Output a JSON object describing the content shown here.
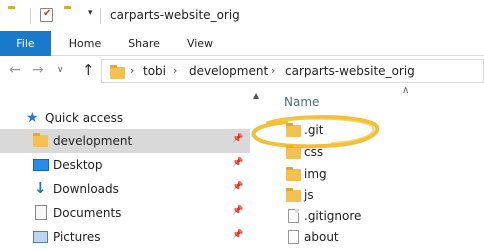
{
  "window": {
    "title": "carparts-website_orig"
  },
  "quick_access_toolbar": {
    "icons": [
      "folder-icon",
      "properties-icon",
      "new-folder-icon",
      "dropdown-icon"
    ],
    "dropdown_glyph": "▾"
  },
  "ribbon": {
    "tabs": [
      {
        "label": "File"
      },
      {
        "label": "Home"
      },
      {
        "label": "Share"
      },
      {
        "label": "View"
      }
    ]
  },
  "navigation": {
    "back_glyph": "←",
    "forward_glyph": "→",
    "recent_glyph": "∨",
    "up_glyph": "↑",
    "breadcrumb": [
      "tobi",
      "development",
      "carparts-website_orig"
    ],
    "breadcrumb_separator": "›"
  },
  "nav_pane": {
    "quick_access_label": "Quick access",
    "items": [
      {
        "label": "development",
        "icon": "folder-icon",
        "pinned": true,
        "selected": true
      },
      {
        "label": "Desktop",
        "icon": "desktop-icon",
        "pinned": true
      },
      {
        "label": "Downloads",
        "icon": "download-icon",
        "pinned": true
      },
      {
        "label": "Documents",
        "icon": "documents-icon",
        "pinned": true
      },
      {
        "label": "Pictures",
        "icon": "pictures-icon",
        "pinned": true
      }
    ],
    "pin_glyph": "📌"
  },
  "file_list": {
    "column_name": "Name",
    "collapse_glyph": "∧",
    "items": [
      {
        "name": ".git",
        "icon": "folder-icon",
        "highlighted": true
      },
      {
        "name": "css",
        "icon": "folder-icon"
      },
      {
        "name": "img",
        "icon": "folder-icon"
      },
      {
        "name": "js",
        "icon": "folder-icon"
      },
      {
        "name": ".gitignore",
        "icon": "file-icon"
      },
      {
        "name": "about",
        "icon": "text-file-icon"
      }
    ]
  },
  "colors": {
    "accent": "#1979ca",
    "highlight_ring": "#f0b418",
    "folder": "#f2c14e"
  }
}
